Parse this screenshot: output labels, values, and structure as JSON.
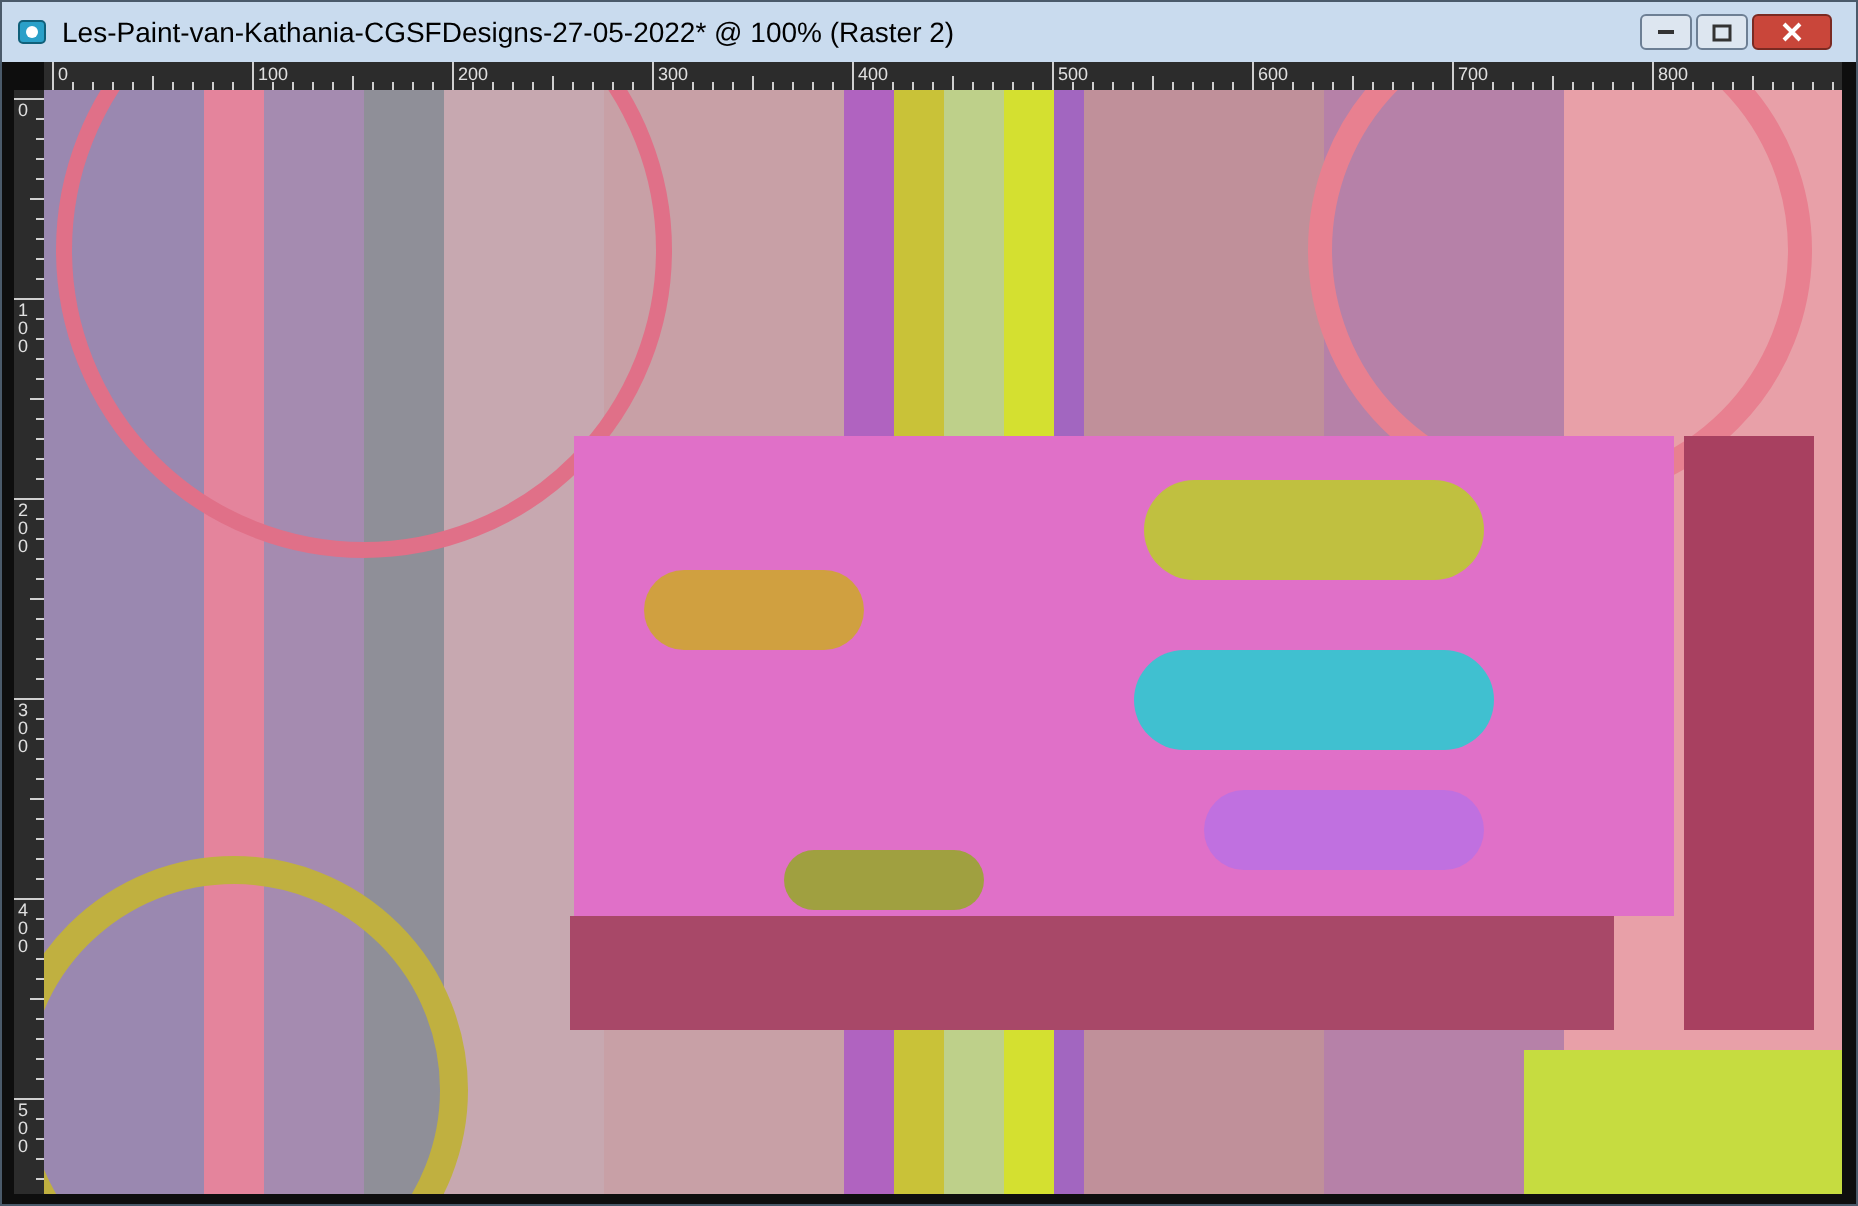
{
  "window": {
    "title": "Les-Paint-van-Kathania-CGSFDesigns-27-05-2022* @ 100% (Raster 2)"
  },
  "ruler_top": {
    "labels": [
      "0",
      "100",
      "200",
      "300",
      "400",
      "500",
      "600",
      "700",
      "800"
    ]
  },
  "ruler_left": {
    "labels": [
      "0",
      "100",
      "200",
      "300",
      "400",
      "500"
    ]
  }
}
